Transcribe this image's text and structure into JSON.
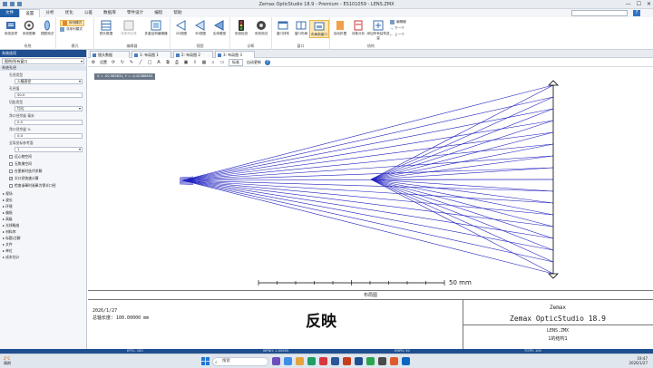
{
  "window": {
    "title": "Zemax OpticStudio 18.9 - Premium - ES101059 - LENS.ZMX",
    "minimize": "—",
    "maximize": "☐",
    "close": "✕"
  },
  "ribbon_tabs": [
    "文件",
    "设置",
    "分析",
    "优化",
    "公差",
    "数据库",
    "零件设计",
    "编程",
    "帮助"
  ],
  "ribbon_search_placeholder": "",
  "ribbon": {
    "system": {
      "label": "系统",
      "buttons": [
        "系统选项",
        "系统图像",
        "视图测试"
      ]
    },
    "mode": {
      "label": "模式",
      "items": [
        "序列模式",
        "非序列模式"
      ]
    },
    "editors": {
      "label": "编辑器",
      "buttons": [
        "镜头数据",
        "非序列元件",
        "多重结构编辑器"
      ]
    },
    "views": {
      "label": "视图",
      "buttons": [
        "2D视图",
        "3D视图",
        "实体模型"
      ]
    },
    "diagnostics": {
      "label": "诊断",
      "buttons": [
        "系统检查",
        "系统测试"
      ]
    },
    "windows": {
      "label": "窗口",
      "buttons": [
        "窗口排布",
        "窗口布局",
        "布局新窗口"
      ]
    },
    "structure": {
      "label": "结构",
      "buttons": [
        "自动折叠",
        "对象分析",
        "添加所有结构变量"
      ],
      "small": [
        "编辑器",
        "下一个",
        "上一个"
      ]
    }
  },
  "left_panel": {
    "header": "系统选项",
    "dropdown": "图例/所有窗口",
    "section_aperture": "系统孔径",
    "aperture_type_label": "孔径类型",
    "aperture_type_value": "入瞳直径",
    "aperture_value_label": "孔径值",
    "aperture_value": "50.0",
    "apodization_label": "切趾类型",
    "apodization_value": "均匀",
    "clear_label": "净口径余量 毫米",
    "clear_value": "0.0",
    "clear_pct_label": "净口径余量 %",
    "clear_pct_value": "0.0",
    "global_ref_label": "全局坐标参考面",
    "global_ref_value": "1",
    "checkboxes": [
      {
        "label": "远心物空间",
        "checked": false
      },
      {
        "label": "无焦像空间",
        "checked": false
      },
      {
        "label": "在更新时迭代求解",
        "checked": false
      },
      {
        "label": "半口径快速计算",
        "checked": true
      },
      {
        "label": "检查渐晕时渐晕为零半口径",
        "checked": false
      }
    ],
    "tree": [
      "视场",
      "波长",
      "环境",
      "偏振",
      "高级",
      "光线瞄准",
      "材料库",
      "标题/注解",
      "文件",
      "单位",
      "成本估计"
    ]
  },
  "doc_tabs": [
    "镜头数据",
    "1: 布局图 1",
    "2: 布局图 2",
    "3: 布局图 3"
  ],
  "view_toolbar": {
    "settings": "设置",
    "slider": "标准",
    "autoupdate": "自动更新"
  },
  "coord_tip": "X = -50.585831, Y = -0.20388855",
  "drawing": {
    "scale_label": "50 mm",
    "caption": "布局图",
    "date": "2026/1/27",
    "total_length": "总轴长度:   100.00000 mm",
    "big_text": "反映",
    "brand": "Zemax",
    "product": "Zemax OpticStudio 18.9",
    "file": "LENS.ZMX",
    "config": "1的结构1"
  },
  "status": [
    "EFFL: 100",
    "WFNO: 2.00455",
    "ENPD: 50",
    "TOTR: 100"
  ],
  "taskbar": {
    "weather_temp": "2°C",
    "weather_text": "晴朗",
    "search": "搜索",
    "time": "19:47",
    "date": "2026/1/27"
  },
  "colors": {
    "ray": "#2020c0",
    "status_bar": "#1f4f8f",
    "file_tab": "#1e5fa8"
  }
}
